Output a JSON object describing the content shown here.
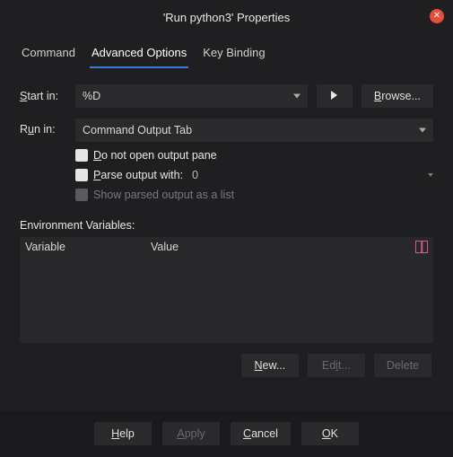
{
  "title": "'Run python3' Properties",
  "tabs": {
    "command": "Command",
    "advanced": "Advanced Options",
    "keybind": "Key Binding"
  },
  "labels": {
    "startin": "Start in:",
    "runin": "Run in:",
    "browse": "Browse...",
    "donotopen": "Do not open output pane",
    "parsewith": "Parse output with:",
    "parseval": "0",
    "showparsed": "Show parsed output as a list",
    "envvars": "Environment Variables:",
    "variable": "Variable",
    "value": "Value",
    "new": "New...",
    "edit": "Edit...",
    "delete": "Delete",
    "help": "Help",
    "apply": "Apply",
    "cancel": "Cancel",
    "ok": "OK"
  },
  "values": {
    "startin": "%D",
    "runin": "Command Output Tab"
  }
}
